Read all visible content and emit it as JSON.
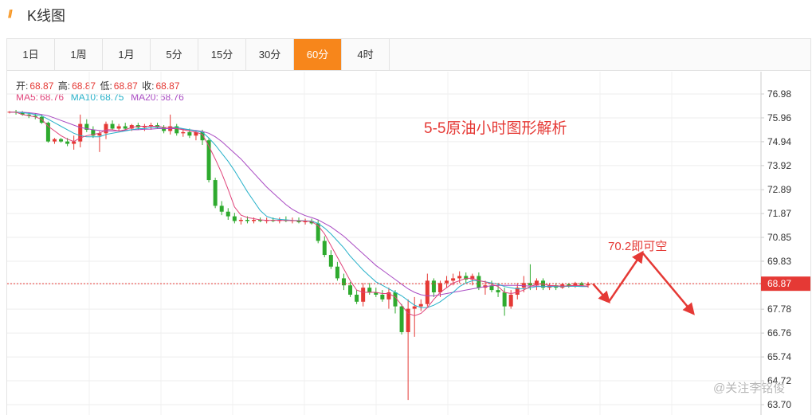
{
  "header": {
    "logo_icon": "double-slash-icon",
    "title": "K线图"
  },
  "tabs": [
    {
      "label": "1日",
      "active": false
    },
    {
      "label": "1周",
      "active": false
    },
    {
      "label": "1月",
      "active": false
    },
    {
      "label": "5分",
      "active": false
    },
    {
      "label": "15分",
      "active": false
    },
    {
      "label": "30分",
      "active": false
    },
    {
      "label": "60分",
      "active": true
    },
    {
      "label": "4时",
      "active": false
    }
  ],
  "ohlc": {
    "open_label": "开:",
    "open": "68.87",
    "high_label": "高:",
    "high": "68.87",
    "low_label": "低:",
    "low": "68.87",
    "close_label": "收:",
    "close": "68.87"
  },
  "ma": {
    "ma5_label": "MA5:",
    "ma5": "68.76",
    "ma10_label": "MA10:",
    "ma10": "68.75",
    "ma20_label": "MA20:",
    "ma20": "68.76"
  },
  "annotations": {
    "headline": "5-5原油小时图形解析",
    "target": "70.2即可空"
  },
  "watermark": "@关注李铭俊",
  "colors": {
    "up": "#e53935",
    "down": "#2eaa2e",
    "accent": "#f7861b",
    "ma5": "#e0437a",
    "ma10": "#27b1c9",
    "ma20": "#a94bc3"
  },
  "chart_data": {
    "type": "candlestick",
    "ylim": [
      63.7,
      77.5
    ],
    "y_ticks": [
      "76.98",
      "75.96",
      "74.94",
      "73.92",
      "72.89",
      "71.87",
      "70.85",
      "69.83",
      "68.87",
      "67.78",
      "66.76",
      "65.74",
      "64.72",
      "63.70"
    ],
    "current_price": "68.87",
    "candles": [
      [
        76.2,
        76.25,
        76.15,
        76.22
      ],
      [
        76.22,
        76.3,
        76.1,
        76.18
      ],
      [
        76.18,
        76.25,
        76.05,
        76.1
      ],
      [
        76.1,
        76.2,
        75.95,
        76.05
      ],
      [
        76.05,
        76.15,
        75.9,
        76.0
      ],
      [
        76.0,
        76.1,
        75.7,
        75.75
      ],
      [
        75.75,
        75.8,
        74.9,
        74.95
      ],
      [
        74.95,
        75.1,
        74.85,
        75.05
      ],
      [
        75.05,
        75.1,
        74.9,
        74.95
      ],
      [
        74.95,
        75.1,
        74.75,
        74.85
      ],
      [
        74.85,
        75.2,
        74.6,
        74.95
      ],
      [
        74.95,
        76.1,
        74.7,
        75.7
      ],
      [
        75.7,
        75.9,
        75.35,
        75.45
      ],
      [
        75.45,
        75.6,
        75.1,
        75.2
      ],
      [
        75.2,
        75.4,
        74.5,
        75.3
      ],
      [
        75.3,
        75.8,
        75.05,
        75.7
      ],
      [
        75.7,
        75.85,
        75.45,
        75.5
      ],
      [
        75.5,
        75.7,
        75.4,
        75.6
      ],
      [
        75.6,
        75.75,
        75.45,
        75.5
      ],
      [
        75.5,
        75.7,
        75.4,
        75.65
      ],
      [
        75.65,
        75.75,
        75.45,
        75.55
      ],
      [
        75.55,
        75.7,
        75.4,
        75.6
      ],
      [
        75.6,
        75.75,
        75.45,
        75.65
      ],
      [
        75.65,
        75.75,
        75.5,
        75.55
      ],
      [
        75.55,
        75.65,
        75.3,
        75.4
      ],
      [
        75.4,
        76.1,
        75.25,
        75.6
      ],
      [
        75.6,
        75.7,
        75.2,
        75.3
      ],
      [
        75.3,
        75.45,
        75.15,
        75.35
      ],
      [
        75.35,
        75.5,
        75.1,
        75.2
      ],
      [
        75.2,
        75.4,
        75.0,
        75.35
      ],
      [
        75.35,
        75.45,
        74.8,
        75.0
      ],
      [
        75.0,
        75.1,
        73.2,
        73.3
      ],
      [
        73.3,
        73.4,
        72.1,
        72.2
      ],
      [
        72.2,
        72.4,
        71.8,
        71.95
      ],
      [
        71.95,
        72.1,
        71.6,
        71.75
      ],
      [
        71.75,
        71.9,
        71.45,
        71.55
      ],
      [
        71.55,
        71.7,
        71.4,
        71.6
      ],
      [
        71.6,
        71.75,
        71.45,
        71.55
      ],
      [
        71.55,
        71.7,
        71.45,
        71.6
      ],
      [
        71.6,
        71.7,
        71.5,
        71.55
      ],
      [
        71.55,
        71.7,
        71.45,
        71.6
      ],
      [
        71.6,
        71.7,
        71.5,
        71.55
      ],
      [
        71.55,
        71.7,
        71.45,
        71.6
      ],
      [
        71.6,
        71.75,
        71.5,
        71.55
      ],
      [
        71.55,
        71.7,
        71.45,
        71.58
      ],
      [
        71.58,
        71.7,
        71.45,
        71.5
      ],
      [
        71.5,
        71.65,
        71.4,
        71.55
      ],
      [
        71.55,
        71.65,
        71.4,
        71.45
      ],
      [
        71.45,
        71.6,
        70.6,
        70.7
      ],
      [
        70.7,
        70.9,
        70.0,
        70.1
      ],
      [
        70.1,
        70.3,
        69.5,
        69.6
      ],
      [
        69.6,
        69.8,
        69.0,
        69.1
      ],
      [
        69.1,
        69.3,
        68.6,
        68.8
      ],
      [
        68.8,
        68.95,
        68.3,
        68.4
      ],
      [
        68.4,
        68.6,
        68.0,
        68.1
      ],
      [
        68.1,
        68.9,
        67.9,
        68.7
      ],
      [
        68.7,
        68.9,
        68.4,
        68.5
      ],
      [
        68.5,
        68.7,
        68.3,
        68.4
      ],
      [
        68.4,
        68.6,
        68.1,
        68.2
      ],
      [
        68.2,
        68.7,
        67.8,
        68.5
      ],
      [
        68.5,
        68.6,
        67.6,
        67.9
      ],
      [
        67.9,
        68.0,
        66.7,
        66.8
      ],
      [
        66.8,
        68.2,
        63.9,
        67.8
      ],
      [
        67.8,
        68.3,
        66.6,
        67.9
      ],
      [
        67.9,
        68.2,
        67.7,
        68.0
      ],
      [
        68.0,
        69.3,
        67.9,
        69.0
      ],
      [
        69.0,
        69.1,
        68.3,
        68.5
      ],
      [
        68.5,
        69.0,
        68.3,
        68.9
      ],
      [
        68.9,
        69.2,
        68.7,
        69.0
      ],
      [
        69.0,
        69.3,
        68.8,
        69.1
      ],
      [
        69.1,
        69.4,
        68.9,
        69.2
      ],
      [
        69.2,
        69.35,
        68.9,
        69.05
      ],
      [
        69.05,
        69.3,
        68.8,
        69.2
      ],
      [
        69.2,
        69.35,
        68.6,
        68.7
      ],
      [
        68.7,
        69.0,
        68.4,
        68.8
      ],
      [
        68.8,
        69.0,
        68.5,
        68.6
      ],
      [
        68.6,
        68.9,
        68.3,
        68.5
      ],
      [
        68.5,
        68.7,
        67.5,
        67.9
      ],
      [
        67.9,
        68.6,
        67.8,
        68.4
      ],
      [
        68.4,
        68.9,
        68.2,
        68.7
      ],
      [
        68.7,
        69.2,
        68.5,
        68.9
      ],
      [
        68.9,
        69.7,
        68.6,
        68.8
      ],
      [
        68.8,
        69.1,
        68.6,
        69.0
      ],
      [
        69.0,
        69.1,
        68.6,
        68.7
      ],
      [
        68.7,
        68.9,
        68.6,
        68.8
      ],
      [
        68.8,
        68.9,
        68.6,
        68.7
      ],
      [
        68.7,
        68.9,
        68.65,
        68.85
      ],
      [
        68.85,
        68.9,
        68.7,
        68.75
      ],
      [
        68.75,
        68.95,
        68.7,
        68.9
      ],
      [
        68.9,
        68.95,
        68.75,
        68.8
      ],
      [
        68.8,
        68.95,
        68.7,
        68.87
      ]
    ],
    "ma5": [
      76.2,
      76.2,
      76.1,
      76.05,
      76.0,
      75.9,
      75.6,
      75.4,
      75.2,
      75.05,
      74.95,
      75.1,
      75.2,
      75.25,
      75.3,
      75.45,
      75.45,
      75.4,
      75.45,
      75.55,
      75.6,
      75.6,
      75.6,
      75.6,
      75.55,
      75.55,
      75.5,
      75.45,
      75.4,
      75.35,
      75.25,
      74.75,
      74.2,
      73.6,
      72.9,
      72.15,
      71.8,
      71.7,
      71.65,
      71.6,
      71.58,
      71.58,
      71.58,
      71.57,
      71.57,
      71.56,
      71.55,
      71.53,
      71.35,
      71.0,
      70.5,
      70.0,
      69.5,
      69.0,
      68.6,
      68.5,
      68.5,
      68.5,
      68.45,
      68.45,
      68.3,
      67.95,
      67.6,
      67.5,
      67.6,
      67.85,
      68.2,
      68.5,
      68.7,
      68.9,
      69.0,
      69.1,
      69.1,
      69.0,
      68.95,
      68.85,
      68.75,
      68.5,
      68.45,
      68.5,
      68.6,
      68.75,
      68.85,
      68.85,
      68.8,
      68.78,
      68.77,
      68.78,
      68.8,
      68.79,
      68.76
    ],
    "ma10": [
      76.2,
      76.2,
      76.18,
      76.15,
      76.1,
      76.05,
      75.9,
      75.75,
      75.6,
      75.45,
      75.3,
      75.2,
      75.15,
      75.15,
      75.15,
      75.25,
      75.3,
      75.35,
      75.4,
      75.45,
      75.5,
      75.5,
      75.55,
      75.55,
      75.55,
      75.55,
      75.55,
      75.5,
      75.45,
      75.4,
      75.35,
      75.1,
      74.8,
      74.45,
      74.1,
      73.7,
      73.25,
      72.8,
      72.4,
      72.0,
      71.75,
      71.65,
      71.62,
      71.6,
      71.58,
      71.57,
      71.56,
      71.55,
      71.45,
      71.25,
      71.0,
      70.7,
      70.4,
      70.05,
      69.75,
      69.45,
      69.2,
      68.95,
      68.8,
      68.65,
      68.5,
      68.35,
      68.15,
      67.95,
      67.85,
      67.85,
      67.95,
      68.1,
      68.3,
      68.5,
      68.75,
      68.9,
      69.0,
      69.0,
      68.95,
      68.9,
      68.85,
      68.75,
      68.7,
      68.65,
      68.65,
      68.7,
      68.75,
      68.75,
      68.75,
      68.75,
      68.75,
      68.76,
      68.76,
      68.75,
      68.75
    ],
    "ma20": [
      76.2,
      76.2,
      76.2,
      76.18,
      76.15,
      76.1,
      76.05,
      75.95,
      75.85,
      75.75,
      75.65,
      75.55,
      75.5,
      75.45,
      75.42,
      75.4,
      75.4,
      75.4,
      75.42,
      75.45,
      75.45,
      75.47,
      75.48,
      75.5,
      75.5,
      75.5,
      75.5,
      75.48,
      75.45,
      75.42,
      75.38,
      75.3,
      75.15,
      74.95,
      74.7,
      74.45,
      74.2,
      73.9,
      73.6,
      73.3,
      73.0,
      72.75,
      72.5,
      72.25,
      72.05,
      71.9,
      71.78,
      71.7,
      71.6,
      71.45,
      71.3,
      71.1,
      70.9,
      70.65,
      70.4,
      70.15,
      69.9,
      69.65,
      69.45,
      69.25,
      69.05,
      68.85,
      68.65,
      68.5,
      68.4,
      68.35,
      68.35,
      68.4,
      68.45,
      68.5,
      68.55,
      68.6,
      68.65,
      68.7,
      68.75,
      68.78,
      68.8,
      68.8,
      68.8,
      68.8,
      68.78,
      68.77,
      68.77,
      68.76,
      68.76,
      68.76,
      68.76,
      68.76,
      68.76,
      68.76,
      68.76
    ],
    "projection": [
      [
        "now",
        68.87
      ],
      [
        "dip",
        68.1
      ],
      [
        "peak",
        70.2
      ],
      [
        "drop",
        67.6
      ]
    ]
  }
}
